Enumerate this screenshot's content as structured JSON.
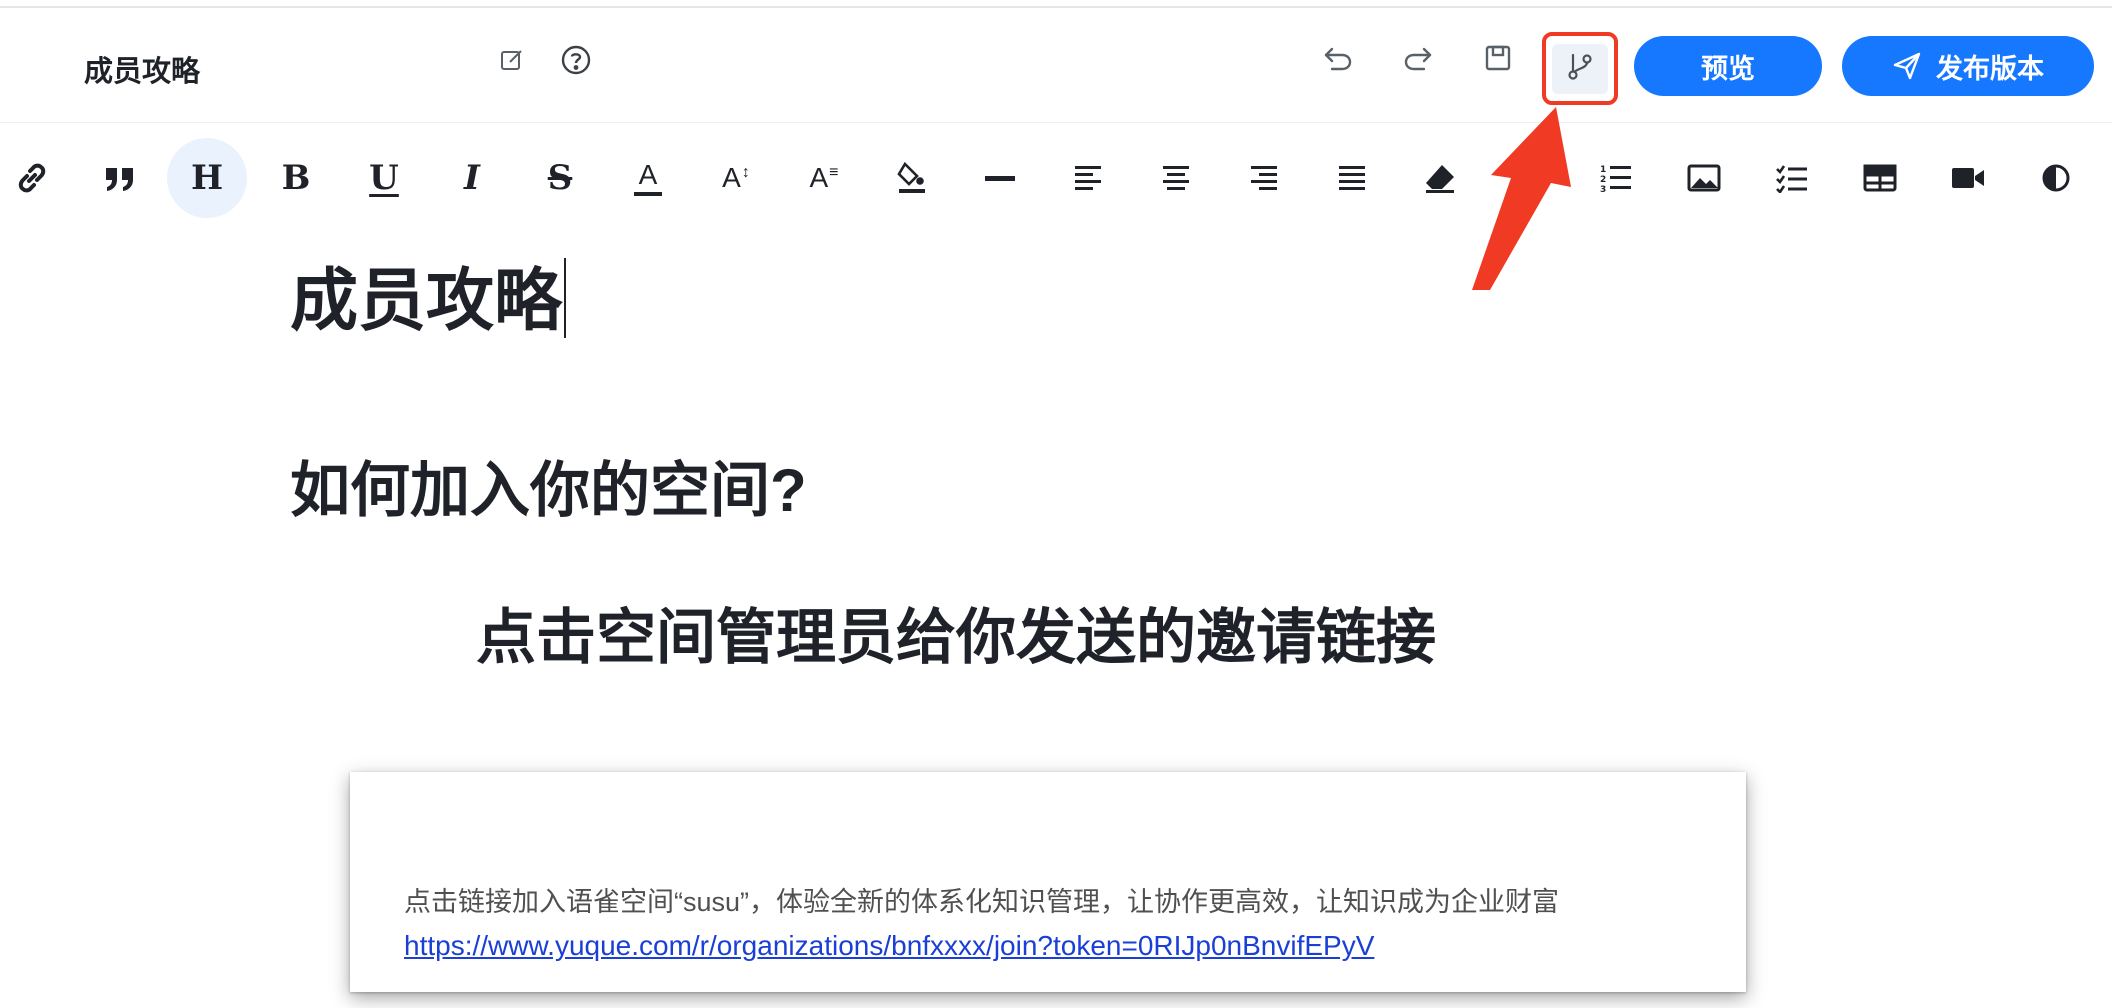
{
  "header": {
    "doc_title": "成员攻略",
    "preview_label": "预览",
    "publish_label": "发布版本"
  },
  "icons": {
    "edit": "edit-icon",
    "help": "help-icon",
    "undo": "undo-icon",
    "redo": "redo-icon",
    "save": "save-icon",
    "branch": "branch-icon",
    "send": "send-icon"
  },
  "toolbar": {
    "heading_letter": "H",
    "bold_letter": "B",
    "underline_letter": "U",
    "italic_letter": "I",
    "strike_letter": "S",
    "font_color_letter": "A",
    "font_size_letter": "A",
    "line_height_letter": "A"
  },
  "content": {
    "h1": "成员攻略",
    "h2": "如何加入你的空间?",
    "h3": "点击空间管理员给你发送的邀请链接",
    "card_text": "点击链接加入语雀空间“susu”，体验全新的体系化知识管理，让协作更高效，让知识成为企业财富",
    "card_link": "https://www.yuque.com/r/organizations/bnfxxxx/join?token=0RIJp0nBnvifEPyV"
  },
  "colors": {
    "primary": "#1677ff",
    "annotation": "#f03a23",
    "active_bg": "#eaf2fd"
  }
}
